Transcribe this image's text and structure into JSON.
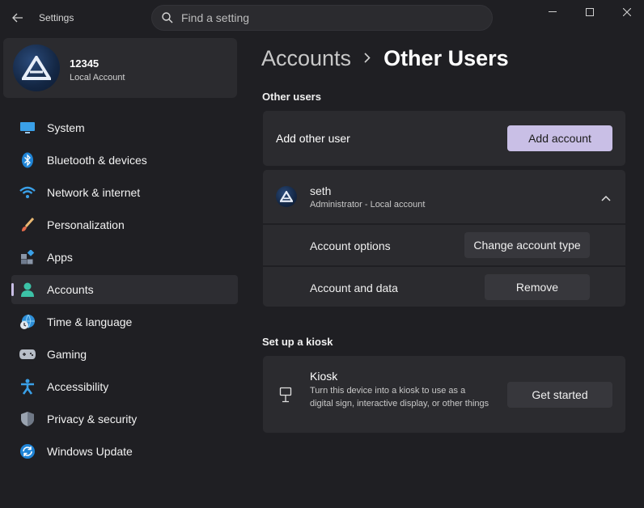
{
  "app": {
    "title": "Settings"
  },
  "search": {
    "placeholder": "Find a setting"
  },
  "profile": {
    "name": "12345",
    "type": "Local Account"
  },
  "nav": [
    {
      "label": "System",
      "icon": "monitor-icon"
    },
    {
      "label": "Bluetooth & devices",
      "icon": "bluetooth-icon"
    },
    {
      "label": "Network & internet",
      "icon": "wifi-icon"
    },
    {
      "label": "Personalization",
      "icon": "brush-icon"
    },
    {
      "label": "Apps",
      "icon": "apps-icon"
    },
    {
      "label": "Accounts",
      "icon": "person-icon",
      "active": true
    },
    {
      "label": "Time & language",
      "icon": "globe-clock-icon"
    },
    {
      "label": "Gaming",
      "icon": "gamepad-icon"
    },
    {
      "label": "Accessibility",
      "icon": "accessibility-icon"
    },
    {
      "label": "Privacy & security",
      "icon": "shield-icon"
    },
    {
      "label": "Windows Update",
      "icon": "update-icon"
    }
  ],
  "breadcrumb": {
    "parent": "Accounts",
    "current": "Other Users"
  },
  "other_users": {
    "section_title": "Other users",
    "add_label": "Add other user",
    "add_button": "Add account",
    "user": {
      "name": "seth",
      "role": "Administrator - Local account",
      "options_label": "Account options",
      "options_button": "Change account type",
      "data_label": "Account and data",
      "data_button": "Remove"
    }
  },
  "kiosk": {
    "section_title": "Set up a kiosk",
    "title": "Kiosk",
    "description": "Turn this device into a kiosk to use as a digital sign, interactive display, or other things",
    "button": "Get started"
  },
  "colors": {
    "accent": "#c9bfe6",
    "background": "#1f1f23",
    "card": "#2b2b2f"
  }
}
